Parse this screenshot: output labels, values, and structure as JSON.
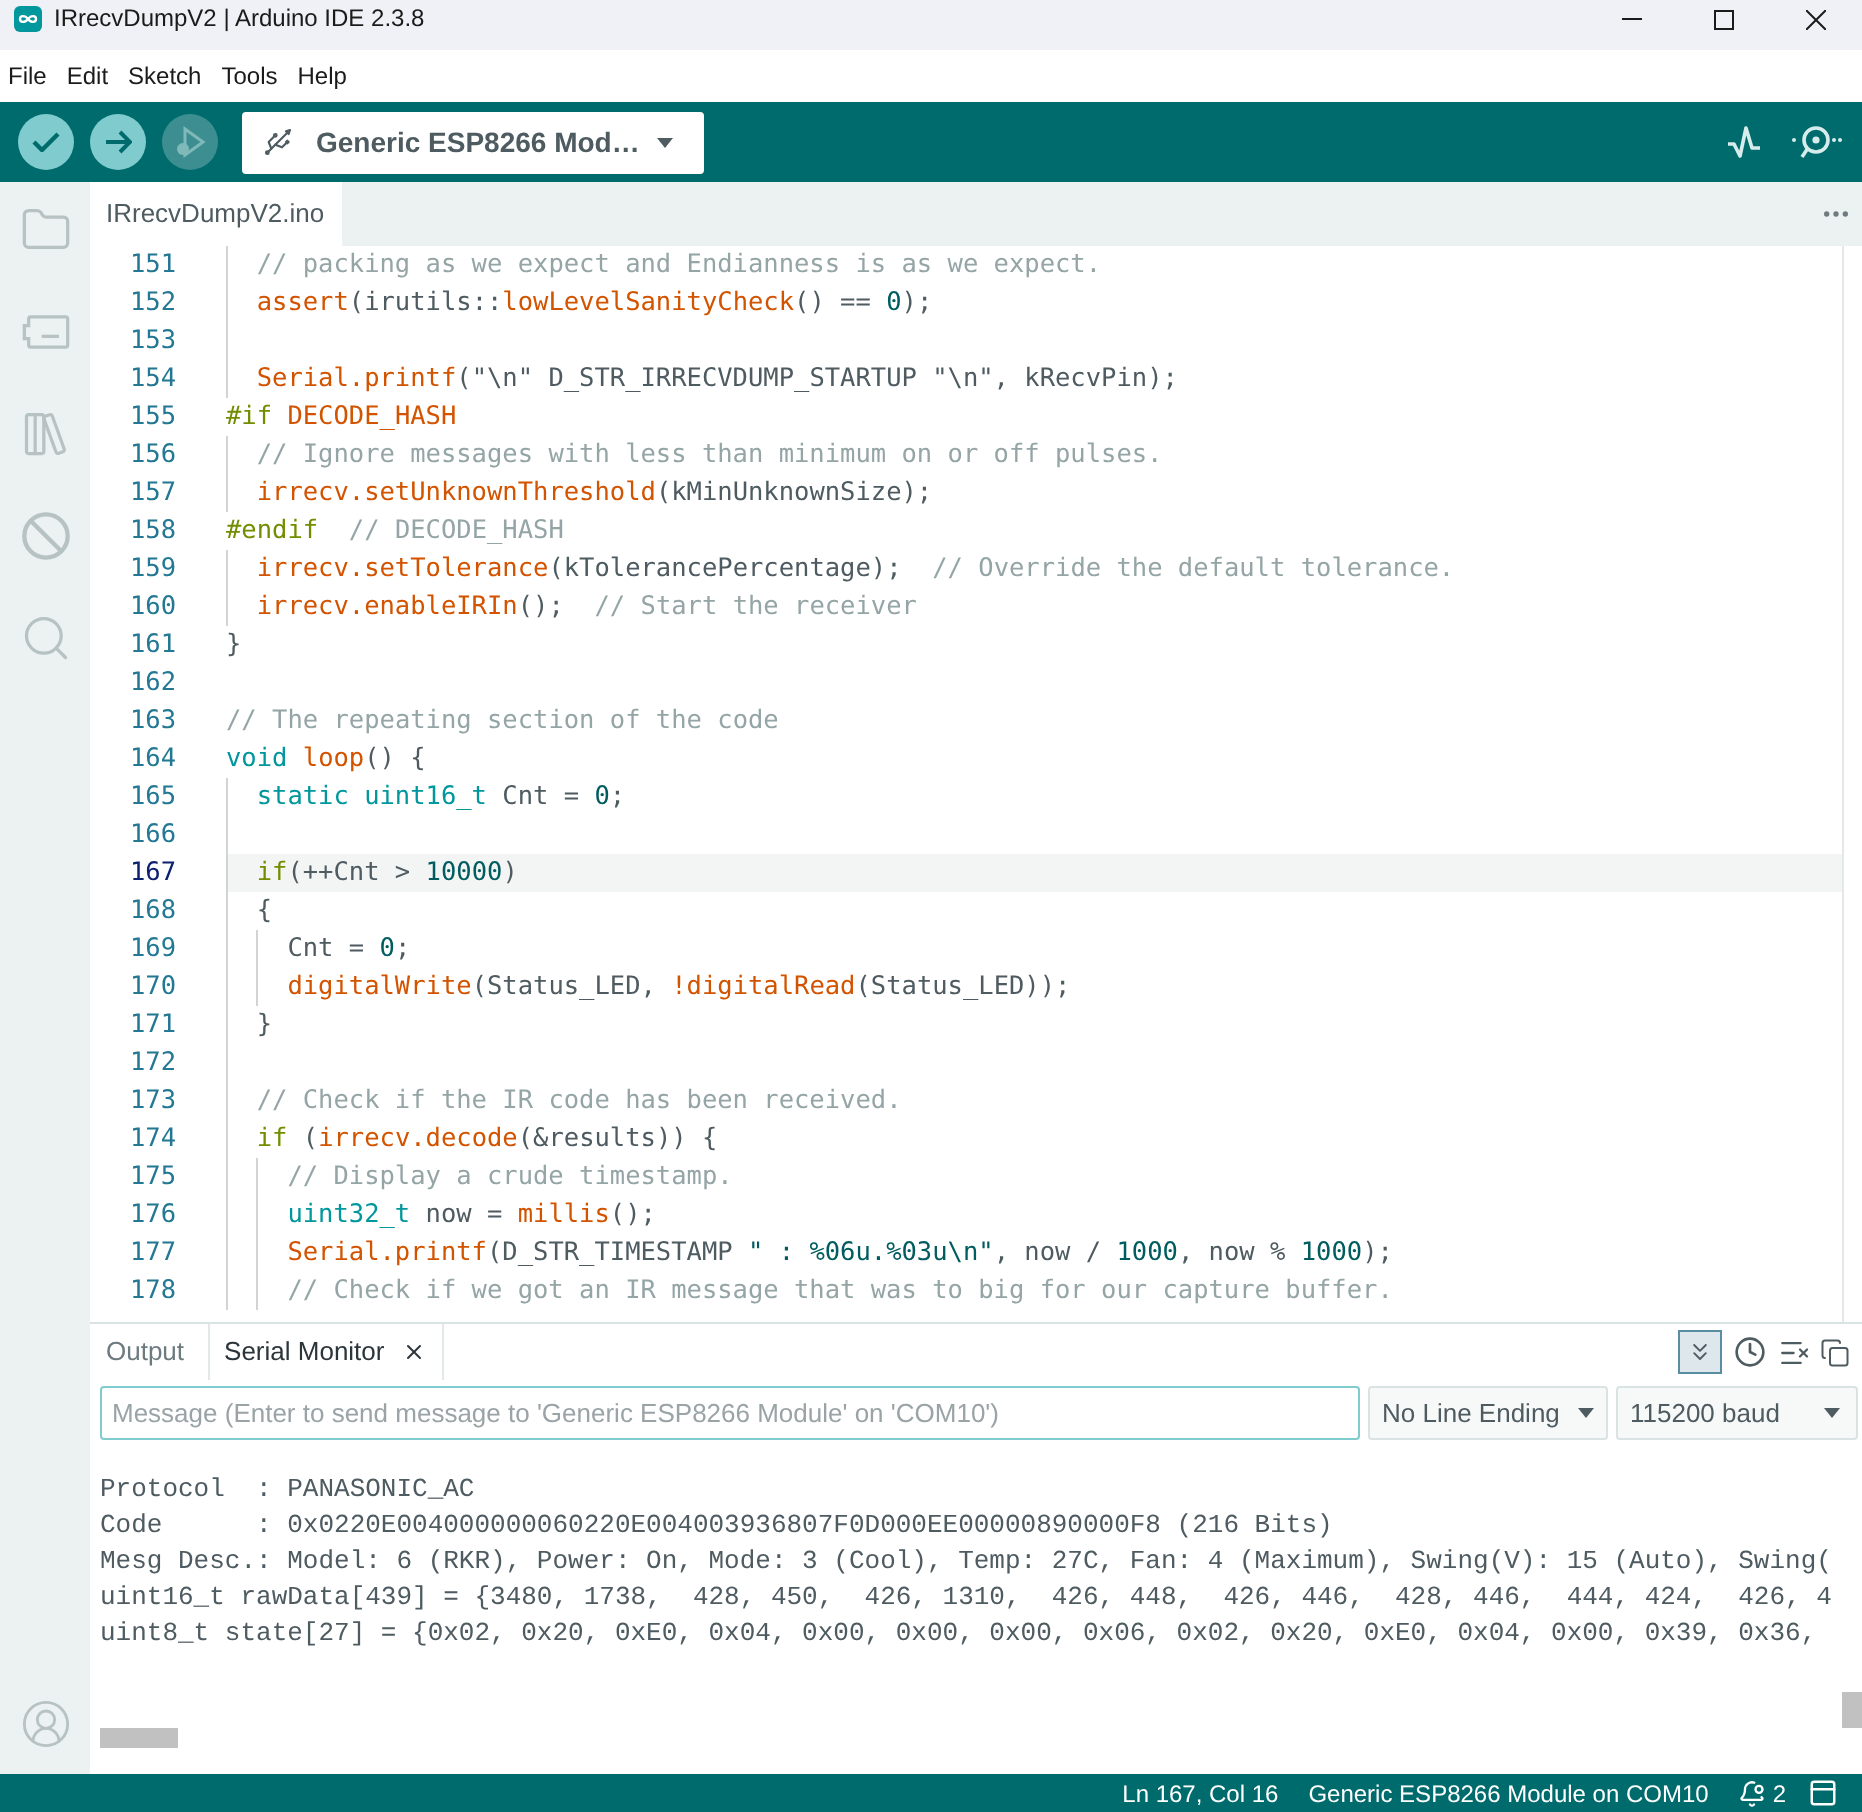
{
  "window": {
    "title": "IRrecvDumpV2 | Arduino IDE 2.3.8"
  },
  "menu": [
    "File",
    "Edit",
    "Sketch",
    "Tools",
    "Help"
  ],
  "toolbar": {
    "verify_button": {
      "disabled": false
    },
    "upload_button": {
      "disabled": false
    },
    "debug_button": {
      "disabled": true
    },
    "board_selector": "Generic ESP8266 Mod…"
  },
  "editor_tabs": [
    {
      "label": "IRrecvDumpV2.ino",
      "selected": true
    }
  ],
  "editor": {
    "lines": [
      {
        "number": "151",
        "current": false,
        "tokens": [
          {
            "text": "  // packing as we expect and Endianness is as we expect.",
            "kind": "comment"
          }
        ]
      },
      {
        "number": "152",
        "current": false,
        "tokens": [
          {
            "text": "  assert",
            "kind": "function"
          },
          {
            "text": "(irutils::",
            "kind": "plain"
          },
          {
            "text": "lowLevelSanityCheck",
            "kind": "function"
          },
          {
            "text": "() == ",
            "kind": "plain"
          },
          {
            "text": "0",
            "kind": "literal"
          },
          {
            "text": ");",
            "kind": "plain"
          }
        ]
      },
      {
        "number": "153",
        "current": false
      },
      {
        "number": "154",
        "current": false,
        "tokens": [
          {
            "text": "  Serial.printf",
            "kind": "function"
          },
          {
            "text": "(\"\\n\" D_STR_IRRECVDUMP_STARTUP \"\\n\", kRecvPin);",
            "kind": "plain"
          }
        ]
      },
      {
        "number": "155",
        "current": false,
        "tokens": [
          {
            "text": "#if",
            "kind": "control"
          },
          {
            "text": " DECODE_HASH",
            "kind": "function"
          }
        ]
      },
      {
        "number": "156",
        "current": false,
        "tokens": [
          {
            "text": "  // Ignore messages with less than minimum on or off pulses.",
            "kind": "comment"
          }
        ]
      },
      {
        "number": "157",
        "current": false,
        "tokens": [
          {
            "text": "  irrecv.setUnknownThreshold",
            "kind": "function"
          },
          {
            "text": "(kMinUnknownSize);",
            "kind": "plain"
          }
        ]
      },
      {
        "number": "158",
        "current": false,
        "tokens": [
          {
            "text": "#endif",
            "kind": "control"
          },
          {
            "text": "  // DECODE_HASH",
            "kind": "comment"
          }
        ]
      },
      {
        "number": "159",
        "current": false,
        "tokens": [
          {
            "text": "  irrecv.setTolerance",
            "kind": "function"
          },
          {
            "text": "(kTolerancePercentage);  ",
            "kind": "plain"
          },
          {
            "text": "// Override the default tolerance.",
            "kind": "comment"
          }
        ]
      },
      {
        "number": "160",
        "current": false,
        "tokens": [
          {
            "text": "  irrecv.enableIRIn",
            "kind": "function"
          },
          {
            "text": "();  ",
            "kind": "plain"
          },
          {
            "text": "// Start the receiver",
            "kind": "comment"
          }
        ]
      },
      {
        "number": "161",
        "current": false,
        "tokens": [
          {
            "text": "}",
            "kind": "plain"
          }
        ]
      },
      {
        "number": "162",
        "current": false
      },
      {
        "number": "163",
        "current": false,
        "tokens": [
          {
            "text": "// The repeating section of the code",
            "kind": "comment"
          }
        ]
      },
      {
        "number": "164",
        "current": false,
        "tokens": [
          {
            "text": "void",
            "kind": "keyword"
          },
          {
            "text": " loop",
            "kind": "function"
          },
          {
            "text": "() {",
            "kind": "plain"
          }
        ]
      },
      {
        "number": "165",
        "current": false,
        "tokens": [
          {
            "text": "  static uint16_t",
            "kind": "keyword"
          },
          {
            "text": " Cnt = ",
            "kind": "plain"
          },
          {
            "text": "0",
            "kind": "literal"
          },
          {
            "text": ";",
            "kind": "plain"
          }
        ]
      },
      {
        "number": "166",
        "current": false
      },
      {
        "number": "167",
        "current": true,
        "tokens": [
          {
            "text": "  if",
            "kind": "control"
          },
          {
            "text": "(++Cnt > ",
            "kind": "plain"
          },
          {
            "text": "10000",
            "kind": "literal"
          },
          {
            "text": ")",
            "kind": "plain"
          }
        ]
      },
      {
        "number": "168",
        "current": false,
        "tokens": [
          {
            "text": "  {",
            "kind": "plain"
          }
        ]
      },
      {
        "number": "169",
        "current": false,
        "tokens": [
          {
            "text": "    Cnt = ",
            "kind": "plain"
          },
          {
            "text": "0",
            "kind": "literal"
          },
          {
            "text": ";",
            "kind": "plain"
          }
        ]
      },
      {
        "number": "170",
        "current": false,
        "tokens": [
          {
            "text": "    digitalWrite",
            "kind": "function"
          },
          {
            "text": "(Status_LED, ",
            "kind": "plain"
          },
          {
            "text": "!digitalRead",
            "kind": "function"
          },
          {
            "text": "(Status_LED));",
            "kind": "plain"
          }
        ]
      },
      {
        "number": "171",
        "current": false,
        "tokens": [
          {
            "text": "  }",
            "kind": "plain"
          }
        ]
      },
      {
        "number": "172",
        "current": false
      },
      {
        "number": "173",
        "current": false,
        "tokens": [
          {
            "text": "  // Check if the IR code has been received.",
            "kind": "comment"
          }
        ]
      },
      {
        "number": "174",
        "current": false,
        "tokens": [
          {
            "text": "  if",
            "kind": "control"
          },
          {
            "text": " (",
            "kind": "plain"
          },
          {
            "text": "irrecv.decode",
            "kind": "function"
          },
          {
            "text": "(&results)) {",
            "kind": "plain"
          }
        ]
      },
      {
        "number": "175",
        "current": false,
        "tokens": [
          {
            "text": "    // Display a crude timestamp.",
            "kind": "comment"
          }
        ]
      },
      {
        "number": "176",
        "current": false,
        "tokens": [
          {
            "text": "    uint32_t",
            "kind": "keyword"
          },
          {
            "text": " now = ",
            "kind": "plain"
          },
          {
            "text": "millis",
            "kind": "function"
          },
          {
            "text": "();",
            "kind": "plain"
          }
        ]
      },
      {
        "number": "177",
        "current": false,
        "tokens": [
          {
            "text": "    Serial.printf",
            "kind": "function"
          },
          {
            "text": "(D_STR_TIMESTAMP ",
            "kind": "plain"
          },
          {
            "text": "\" : %06u.%03u\\n\"",
            "kind": "literal"
          },
          {
            "text": ", now / ",
            "kind": "plain"
          },
          {
            "text": "1000",
            "kind": "literal"
          },
          {
            "text": ", now % ",
            "kind": "plain"
          },
          {
            "text": "1000",
            "kind": "literal"
          },
          {
            "text": ");",
            "kind": "plain"
          }
        ]
      },
      {
        "number": "178",
        "current": false,
        "tokens": [
          {
            "text": "    // Check if we got an IR message that was to big for our capture buffer.",
            "kind": "comment"
          }
        ]
      }
    ]
  },
  "panel": {
    "tabs": [
      {
        "label": "Output",
        "selected": false
      },
      {
        "label": "Serial Monitor",
        "selected": true
      }
    ],
    "autoscroll": {
      "on": true
    },
    "timestamp": {
      "on": false
    },
    "message_field": {
      "placeholder": "Message (Enter to send message to 'Generic ESP8266 Module' on 'COM10')"
    },
    "line_ending": "No Line Ending",
    "baud_rate": "115200 baud",
    "output": [
      "Protocol  : PANASONIC_AC",
      "Code      : 0x0220E004000000060220E004003936807F0D000EE00000890000F8 (216 Bits)",
      "Mesg Desc.: Model: 6 (RKR), Power: On, Mode: 3 (Cool), Temp: 27C, Fan: 4 (Maximum), Swing(V): 15 (Auto), Swing(",
      "uint16_t rawData[439] = {3480, 1738,  428, 450,  426, 1310,  426, 448,  426, 446,  428, 446,  444, 424,  426, 4",
      "uint8_t state[27] = {0x02, 0x20, 0xE0, 0x04, 0x00, 0x00, 0x00, 0x06, 0x02, 0x20, 0xE0, 0x04, 0x00, 0x39, 0x36,"
    ]
  },
  "status_bar": {
    "position": "Ln 167, Col 16",
    "board": "Generic ESP8266 Module on COM10",
    "notifications": "2"
  }
}
